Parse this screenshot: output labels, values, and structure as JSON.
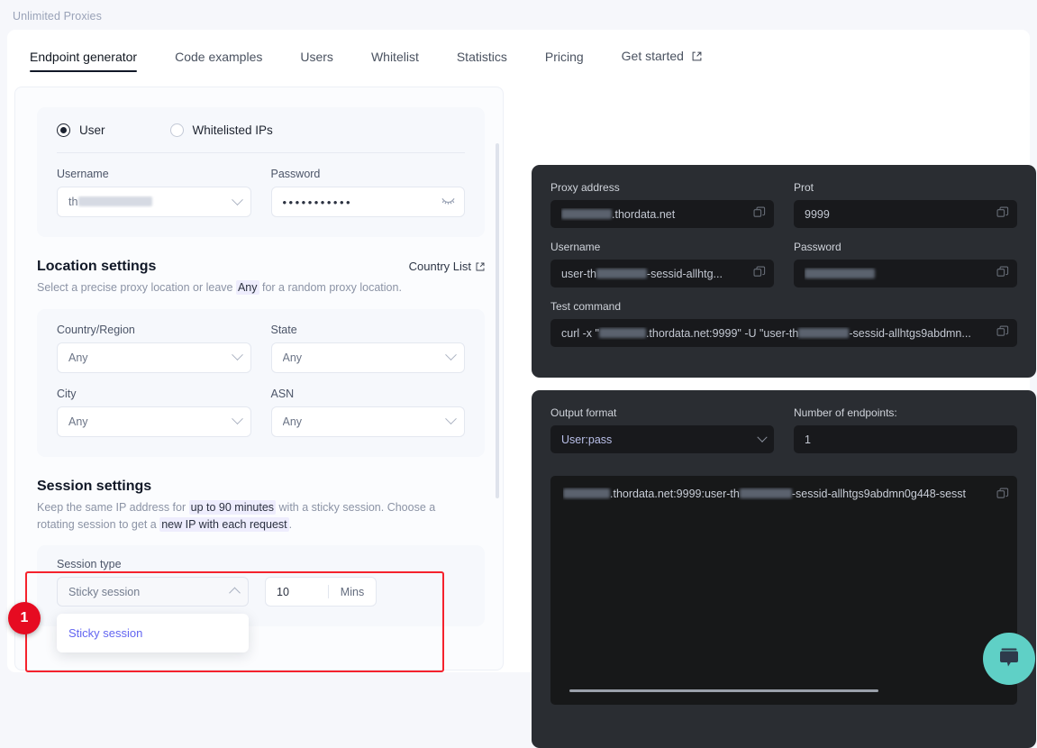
{
  "breadcrumb": "Unlimited Proxies",
  "tabs": [
    {
      "label": "Endpoint generator",
      "active": true
    },
    {
      "label": "Code examples",
      "active": false
    },
    {
      "label": "Users",
      "active": false
    },
    {
      "label": "Whitelist",
      "active": false
    },
    {
      "label": "Statistics",
      "active": false
    },
    {
      "label": "Pricing",
      "active": false
    },
    {
      "label": "Get started",
      "active": false,
      "external": true
    }
  ],
  "auth": {
    "mode_user_label": "User",
    "mode_whitelist_label": "Whitelisted IPs",
    "selected_mode": "User",
    "username_label": "Username",
    "username_value": "th",
    "password_label": "Password",
    "password_value": "•••••••••••"
  },
  "location": {
    "title": "Location settings",
    "link_label": "Country List",
    "desc_before": "Select a precise proxy location or leave ",
    "desc_highlight": "Any",
    "desc_after": " for a random proxy location.",
    "fields": [
      {
        "label": "Country/Region",
        "value": "Any"
      },
      {
        "label": "State",
        "value": "Any"
      },
      {
        "label": "City",
        "value": "Any"
      },
      {
        "label": "ASN",
        "value": "Any"
      }
    ]
  },
  "session": {
    "title": "Session settings",
    "desc_1": "Keep the same IP address for ",
    "desc_hl_1": "up to 90 minutes",
    "desc_2": " with a sticky session. Choose a rotating session to get a ",
    "desc_hl_2": "new IP with each request",
    "desc_3": ".",
    "type_label": "Session type",
    "type_value": "Sticky session",
    "duration_value": "10",
    "duration_unit": "Mins",
    "dropdown_options": [
      "Sticky session"
    ]
  },
  "annotation": {
    "badge": "1"
  },
  "credentials": {
    "proxy_address_label": "Proxy address",
    "proxy_address_value": ".thordata.net",
    "port_label": "Prot",
    "port_value": "9999",
    "username_label": "Username",
    "username_value_prefix": "user-th",
    "username_value_suffix": "-sessid-allhtg...",
    "password_label": "Password",
    "password_value": "",
    "test_command_label": "Test command",
    "test_command_prefix": "curl -x \"",
    "test_command_mid": ".thordata.net:9999\" -U \"user-th",
    "test_command_suffix": "-sessid-allhtgs9abdmn..."
  },
  "output": {
    "format_label": "Output format",
    "format_value": "User:pass",
    "count_label": "Number of endpoints:",
    "count_value": "1",
    "endpoint_prefix": ".thordata.net:9999:user-th",
    "endpoint_suffix": "-sessid-allhtgs9abdmn0g448-sesst"
  },
  "icons": {
    "external_link": "external-link-icon",
    "copy": "copy-icon",
    "eye_off": "eye-off-icon",
    "chat": "chat-bubble-icon"
  }
}
